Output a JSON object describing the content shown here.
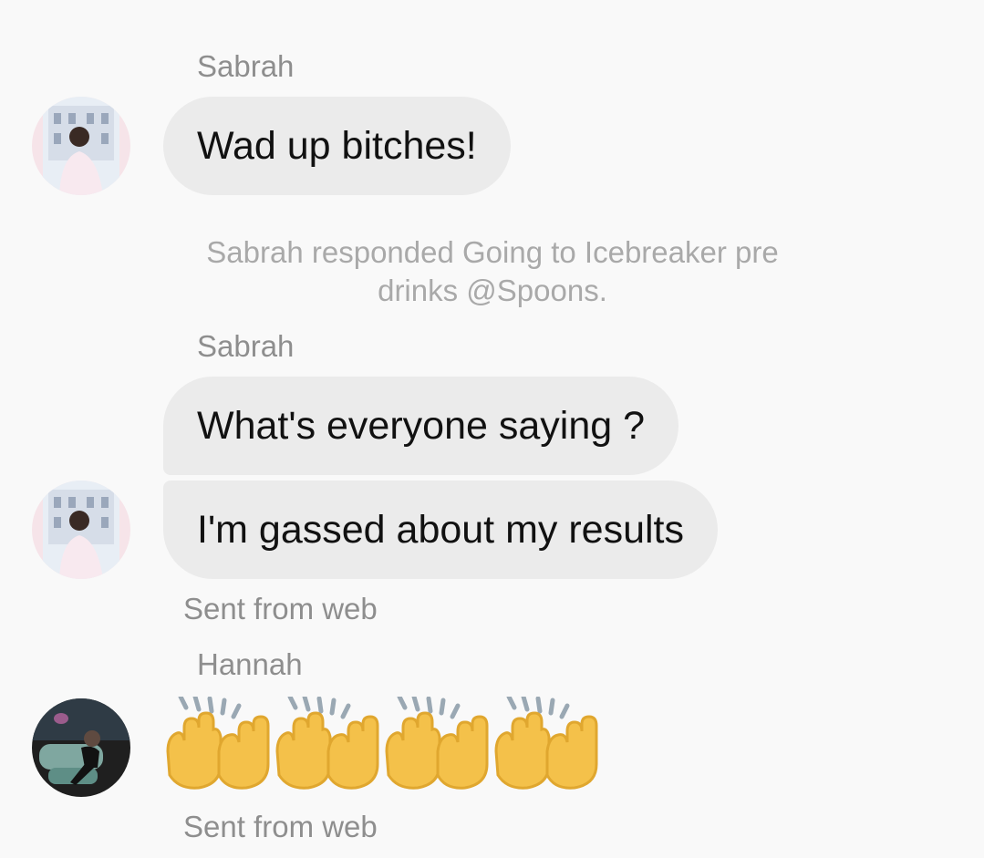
{
  "colors": {
    "background": "#f9f9f9",
    "bubble": "#ebebeb",
    "bubble_text": "#111111",
    "secondary_text": "#8e8e8e",
    "system_text": "#a9a9a9"
  },
  "messages": {
    "group1": {
      "sender": "Sabrah",
      "avatar_icon": "user-avatar-sabrah",
      "bubble1": "Wad up bitches!"
    },
    "system_note": "Sabrah responded Going to Icebreaker pre drinks @Spoons.",
    "group2": {
      "sender": "Sabrah",
      "avatar_icon": "user-avatar-sabrah",
      "bubble1": "What's everyone saying ?",
      "bubble2": "I'm gassed about my results",
      "meta": "Sent from web"
    },
    "group3": {
      "sender": "Hannah",
      "avatar_icon": "user-avatar-hannah",
      "emoji_name": "raising-hands-emoji",
      "emoji_count": 4,
      "meta": "Sent from web"
    }
  }
}
